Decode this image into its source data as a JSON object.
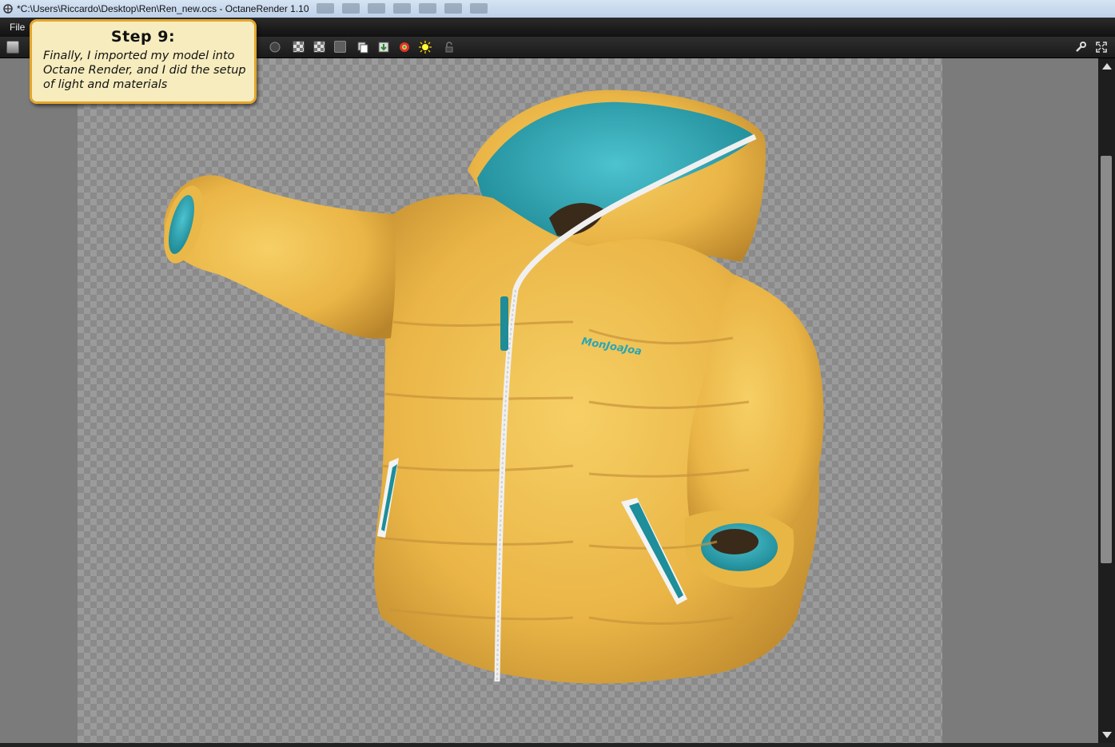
{
  "window": {
    "title": "*C:\\Users\\Riccardo\\Desktop\\Ren\\Ren_new.ocs - OctaneRender 1.10"
  },
  "menu": {
    "items": [
      "File"
    ]
  },
  "callout": {
    "title": "Step 9:",
    "text": "Finally, I imported my model into Octane Render, and I did the setup of light and materials"
  },
  "render": {
    "logo_text": "MonJoaJoa"
  },
  "colors": {
    "accent_border": "#e4a62c",
    "callout_bg": "#f6ecbe",
    "jacket_yellow": "#efbf4c",
    "lining_teal": "#2aa6b4"
  },
  "icons": [
    "app-icon",
    "render-icon",
    "wrench-icon",
    "fullscreen-icon",
    "scroll-up-icon",
    "scroll-down-icon"
  ]
}
